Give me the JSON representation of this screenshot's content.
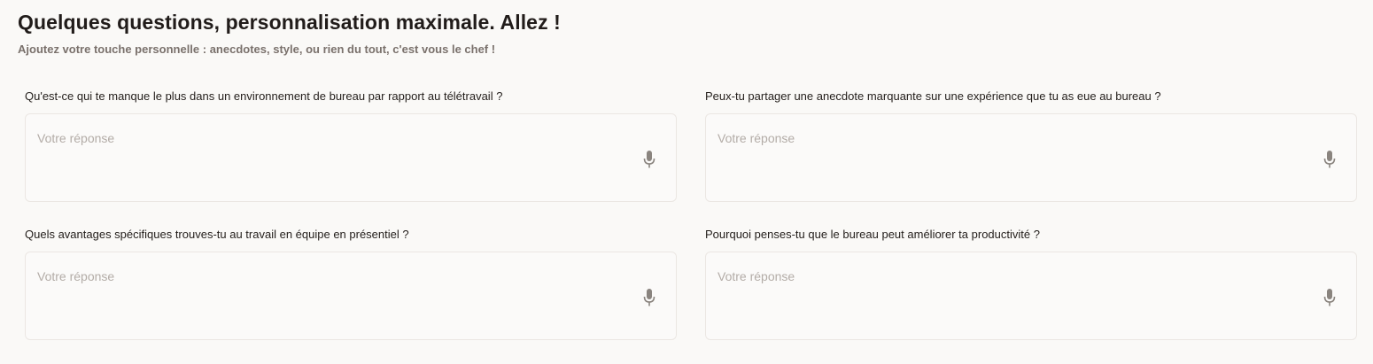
{
  "header": {
    "title": "Quelques questions, personnalisation maximale. Allez !",
    "subtitle": "Ajoutez votre touche personnelle : anecdotes, style, ou rien du tout, c'est vous le chef !"
  },
  "questions": [
    {
      "label": "Qu'est-ce qui te manque le plus dans un environnement de bureau par rapport au télétravail ?",
      "placeholder": "Votre réponse",
      "value": ""
    },
    {
      "label": "Peux-tu partager une anecdote marquante sur une expérience que tu as eue au bureau ?",
      "placeholder": "Votre réponse",
      "value": ""
    },
    {
      "label": "Quels avantages spécifiques trouves-tu au travail en équipe en présentiel ?",
      "placeholder": "Votre réponse",
      "value": ""
    },
    {
      "label": "Pourquoi penses-tu que le bureau peut améliorer ta productivité ?",
      "placeholder": "Votre réponse",
      "value": ""
    }
  ],
  "icons": {
    "mic": "microphone-icon"
  },
  "colors": {
    "background": "#faf9f7",
    "title": "#211c1a",
    "subtitle": "#7a716c",
    "placeholder": "#b3aca7",
    "border": "#ebe7e3",
    "icon": "#8a847f"
  }
}
